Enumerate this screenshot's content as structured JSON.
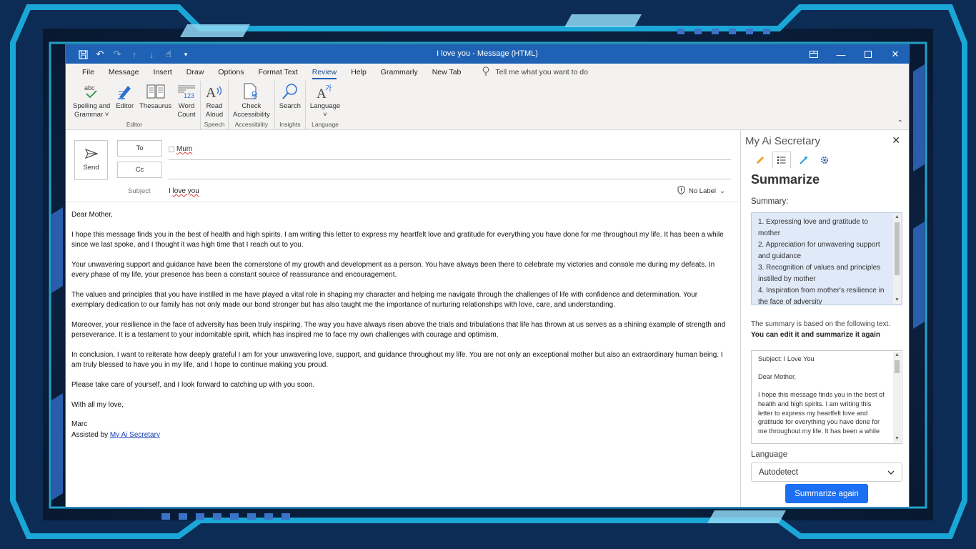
{
  "window": {
    "title": "I love you  -  Message (HTML)"
  },
  "menu": {
    "tabs": [
      "File",
      "Message",
      "Insert",
      "Draw",
      "Options",
      "Format Text",
      "Review",
      "Help",
      "Grammarly",
      "New Tab"
    ],
    "active_tab": "Review",
    "tell_me": "Tell me what you want to do"
  },
  "ribbon": {
    "groups": [
      {
        "label": "Editor",
        "buttons": [
          {
            "line1": "Spelling and",
            "line2": "Grammar ˅",
            "icon": "spelling-icon"
          },
          {
            "line1": "Editor",
            "line2": "",
            "icon": "editor-icon"
          },
          {
            "line1": "Thesaurus",
            "line2": "",
            "icon": "thesaurus-icon"
          },
          {
            "line1": "Word",
            "line2": "Count",
            "icon": "word-count-icon"
          }
        ]
      },
      {
        "label": "Speech",
        "buttons": [
          {
            "line1": "Read",
            "line2": "Aloud",
            "icon": "read-aloud-icon"
          }
        ]
      },
      {
        "label": "Accessibility",
        "buttons": [
          {
            "line1": "Check",
            "line2": "Accessibility",
            "icon": "check-accessibility-icon"
          }
        ]
      },
      {
        "label": "Insights",
        "buttons": [
          {
            "line1": "Search",
            "line2": "",
            "icon": "search-icon"
          }
        ]
      },
      {
        "label": "Language",
        "buttons": [
          {
            "line1": "Language",
            "line2": "˅",
            "icon": "language-icon"
          }
        ]
      }
    ]
  },
  "compose": {
    "send_label": "Send",
    "to_label": "To",
    "cc_label": "Cc",
    "recipient": "Mum",
    "subject_label": "Subject",
    "subject_word1": "I",
    "subject_word2": "love you",
    "sensitivity": "No Label",
    "body": {
      "greeting": "Dear Mother,",
      "paragraphs": [
        "I hope this message finds you in the best of health and high spirits. I am writing this letter to express my heartfelt love and gratitude for everything you have done for me throughout my life. It has been a while since we last spoke, and I thought it was high time that I reach out to you.",
        "Your unwavering support and guidance have been the cornerstone of my growth and development as a person. You have always been there to celebrate my victories and console me during my defeats. In every phase of my life, your presence has been a constant source of reassurance and encouragement.",
        "The values and principles that you have instilled in me have played a vital role in shaping my character and helping me navigate through the challenges of life with confidence and determination. Your exemplary dedication to our family has not only made our bond stronger but has also taught me the importance of nurturing relationships with love, care, and understanding.",
        "Moreover, your resilience in the face of adversity has been truly inspiring. The way you have always risen above the trials and tribulations that life has thrown at us serves as a shining example of strength and perseverance. It is a testament to your indomitable spirit, which has inspired me to face my own challenges with courage and optimism.",
        "In conclusion, I want to reiterate how deeply grateful I am for your unwavering love, support, and guidance throughout my life. You are not only an exceptional mother but also an extraordinary human being. I am truly blessed to have you in my life, and I hope to continue making you proud.",
        "Please take care of yourself, and I look forward to catching up with you soon.",
        "With all my love,"
      ],
      "signature": "Marc",
      "assisted_prefix": "Assisted by ",
      "assisted_link": "My Ai Secretary"
    }
  },
  "pane": {
    "title": "My Ai Secretary",
    "heading": "Summarize",
    "summary_label": "Summary:",
    "summary_items": [
      "1. Expressing love and gratitude to mother",
      "2. Appreciation for unwavering support and guidance",
      "3. Recognition of values and principles instilled by mother",
      "4. Inspiration from mother's resilience in the face of adversity"
    ],
    "note_plain": "The summary is based on the following text. ",
    "note_bold": "You can edit it and summarize it again",
    "source_subject": "Subject: I Love You",
    "source_greeting": "Dear Mother,",
    "source_para": "I hope this message finds you in the best of health and high spirits. I am writing this letter to express my heartfelt love and gratitude for everything you have done for me throughout my life. It has been a while",
    "language_label": "Language",
    "language_value": "Autodetect",
    "button_label": "Summarize again"
  }
}
